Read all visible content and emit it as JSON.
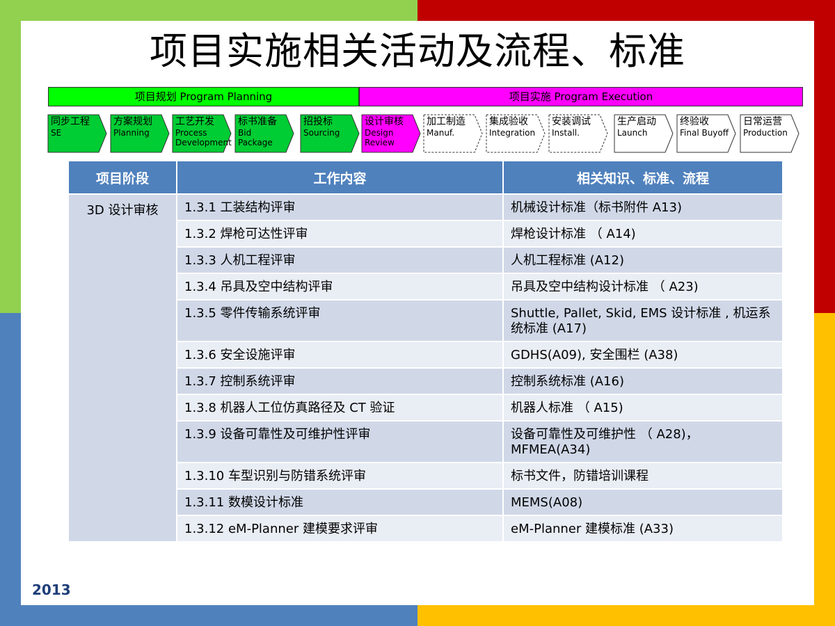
{
  "title": "项目实施相关活动及流程、标准",
  "phases": {
    "planning": "项目规划   Program Planning",
    "execution": "项目实施   Program Execution"
  },
  "steps": [
    {
      "l1": "同步工程",
      "l2": "SE",
      "fill": "#00cc33"
    },
    {
      "l1": "方案规划",
      "l2": "Planning",
      "fill": "#00cc33"
    },
    {
      "l1": "工艺开发",
      "l2": "Process Development",
      "fill": "#00cc33"
    },
    {
      "l1": "标书准备",
      "l2": "Bid Package",
      "fill": "#00cc33"
    },
    {
      "l1": "招投标",
      "l2": "Sourcing",
      "fill": "#00cc33"
    },
    {
      "l1": "设计审核",
      "l2": "Design Review",
      "fill": "#ff00ff"
    },
    {
      "l1": "加工制造",
      "l2": "Manuf.",
      "fill": "#ffffff"
    },
    {
      "l1": "集成验收",
      "l2": "Integration",
      "fill": "#ffffff"
    },
    {
      "l1": "安装调试",
      "l2": "Install.",
      "fill": "#ffffff"
    },
    {
      "l1": "生产启动",
      "l2": "Launch",
      "fill": "#ffffff"
    },
    {
      "l1": "终验收",
      "l2": "Final Buyoff",
      "fill": "#ffffff"
    },
    {
      "l1": "日常运营",
      "l2": "Production",
      "fill": "#ffffff"
    }
  ],
  "table": {
    "headers": [
      "项目阶段",
      "工作内容",
      "相关知识、标准、流程"
    ],
    "phase": "3D 设计审核",
    "rows": [
      {
        "work": "1.3.1  工装结构评审",
        "ref": "机械设计标准（标书附件 A13)"
      },
      {
        "work": "1.3.2  焊枪可达性评审",
        "ref": "焊枪设计标准 （ A14)"
      },
      {
        "work": "1.3.3  人机工程评审",
        "ref": "人机工程标准 (A12)"
      },
      {
        "work": "1.3.4  吊具及空中结构评审",
        "ref": "吊具及空中结构设计标准 （ A23)"
      },
      {
        "work": "1.3.5  零件传输系统评审",
        "ref": "Shuttle, Pallet, Skid, EMS 设计标准 , 机运系统标准 (A17)"
      },
      {
        "work": "1.3.6  安全设施评审",
        "ref": "GDHS(A09), 安全围栏 (A38)"
      },
      {
        "work": "1.3.7  控制系统评审",
        "ref": "控制系统标准 (A16)"
      },
      {
        "work": "1.3.8  机器人工位仿真路径及 CT 验证",
        "ref": "机器人标准 （ A15)"
      },
      {
        "work": "1.3.9  设备可靠性及可维护性评审",
        "ref": "设备可靠性及可维护性 （ A28)，  MFMEA(A34)"
      },
      {
        "work": "1.3.10  车型识别与防错系统评审",
        "ref": "标书文件，防错培训课程"
      },
      {
        "work": "1.3.11  数模设计标准",
        "ref": "MEMS(A08)"
      },
      {
        "work": "1.3.12 eM-Planner 建模要求评审",
        "ref": "eM-Planner 建模标准 (A33)"
      }
    ]
  },
  "footer": "2013"
}
